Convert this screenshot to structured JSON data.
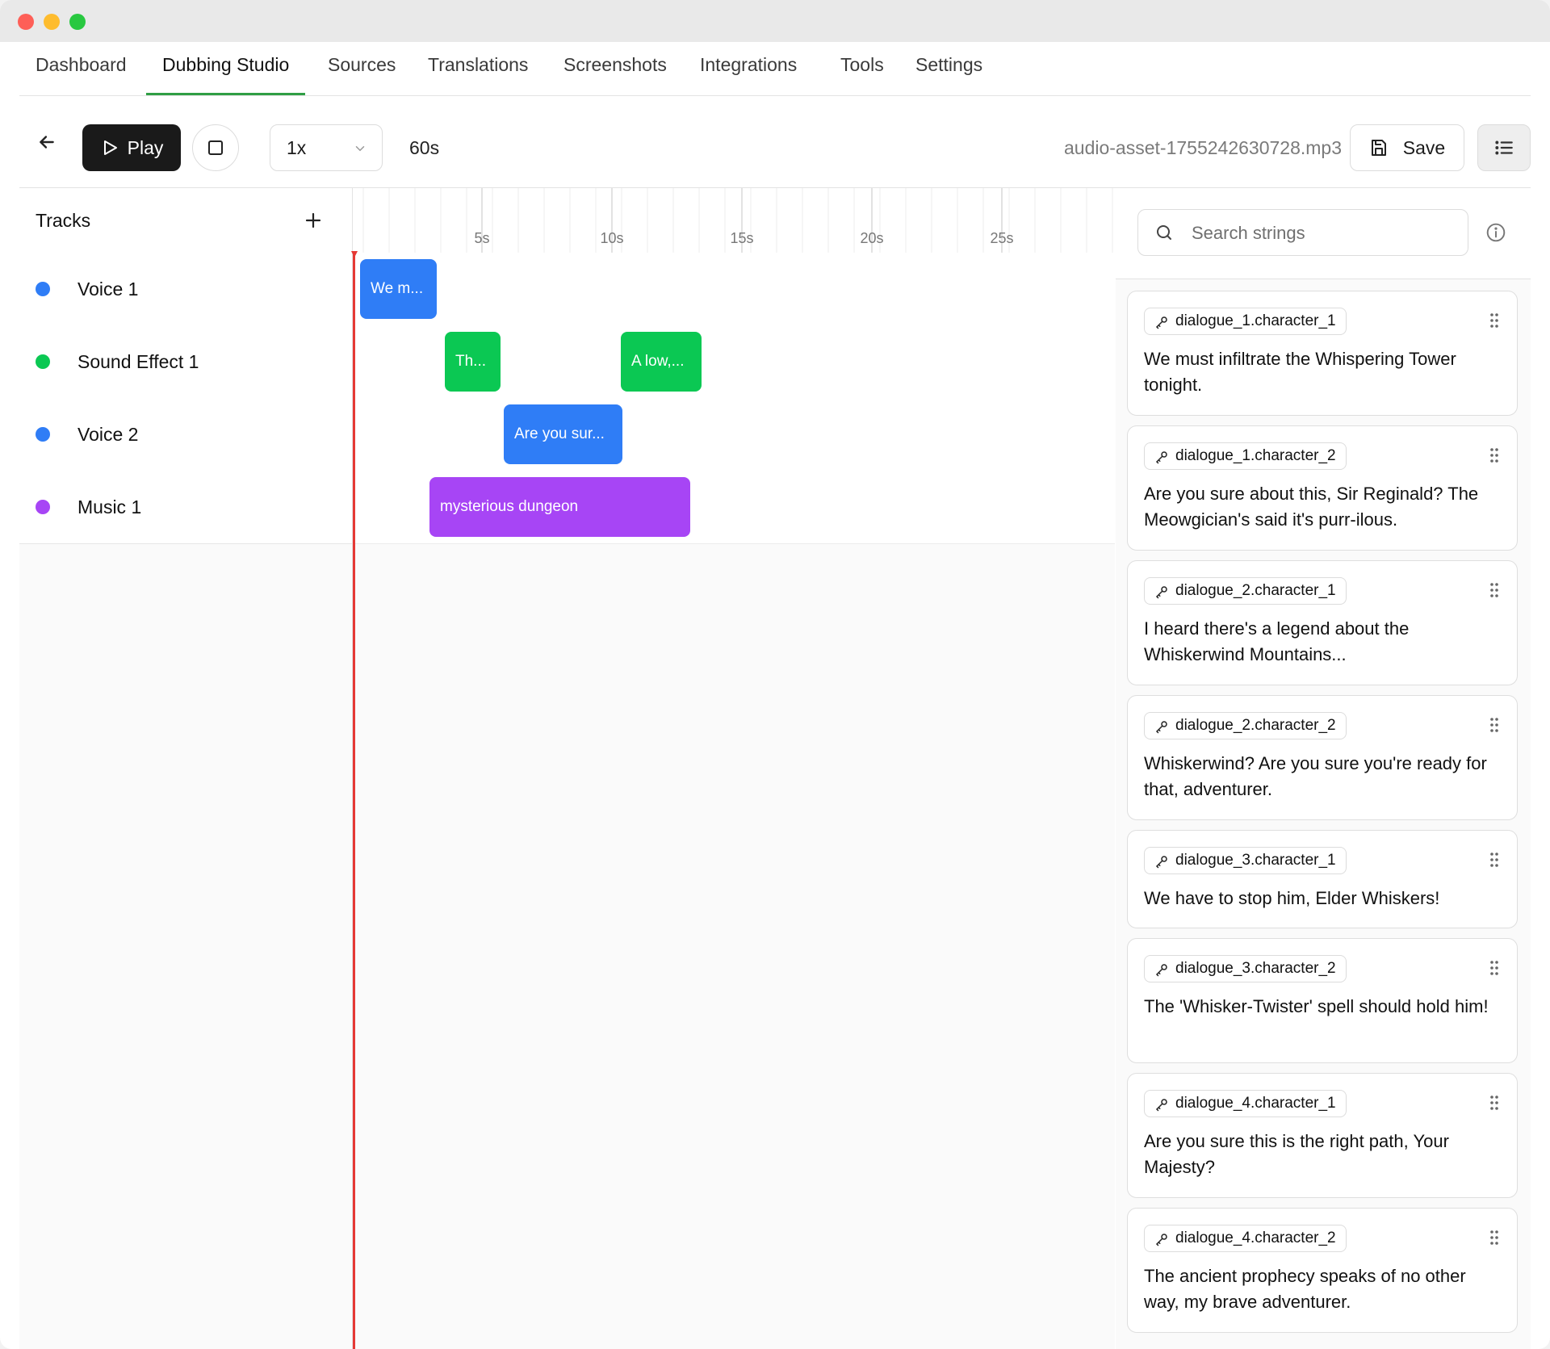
{
  "nav": {
    "tabs": [
      {
        "label": "Dashboard"
      },
      {
        "label": "Dubbing Studio"
      },
      {
        "label": "Sources"
      },
      {
        "label": "Translations"
      },
      {
        "label": "Screenshots"
      },
      {
        "label": "Integrations"
      },
      {
        "label": "Tools"
      },
      {
        "label": "Settings"
      }
    ],
    "active": "Dubbing Studio"
  },
  "toolbar": {
    "play_label": "Play",
    "speed_value": "1x",
    "duration": "60s",
    "filename": "audio-asset-1755242630728.mp3",
    "save_label": "Save"
  },
  "tracks": {
    "title": "Tracks",
    "items": [
      {
        "name": "Voice 1",
        "color": "#2f7df6"
      },
      {
        "name": "Sound Effect 1",
        "color": "#0bc853"
      },
      {
        "name": "Voice 2",
        "color": "#2f7df6"
      },
      {
        "name": "Music 1",
        "color": "#a745f5"
      }
    ]
  },
  "timeline": {
    "tick_labels": [
      "5s",
      "10s",
      "15s",
      "20s",
      "25s"
    ],
    "clips": [
      {
        "track": 0,
        "label": "We m...",
        "color": "#2f7df6"
      },
      {
        "track": 1,
        "label": "Th...",
        "color": "#0bc853"
      },
      {
        "track": 1,
        "label": "A low,...",
        "color": "#0bc853"
      },
      {
        "track": 2,
        "label": "Are you sur...",
        "color": "#2f7df6"
      },
      {
        "track": 3,
        "label": "mysterious dungeon",
        "color": "#a745f5"
      }
    ]
  },
  "strings": {
    "search_placeholder": "Search strings",
    "items": [
      {
        "key": "dialogue_1.character_1",
        "text": "We must infiltrate the Whispering Tower tonight."
      },
      {
        "key": "dialogue_1.character_2",
        "text": "Are you sure about this, Sir Reginald? The Meowgician's said it's purr-ilous."
      },
      {
        "key": "dialogue_2.character_1",
        "text": "I heard there's a legend about the Whiskerwind Mountains..."
      },
      {
        "key": "dialogue_2.character_2",
        "text": "Whiskerwind? Are you sure you're ready for that, adventurer."
      },
      {
        "key": "dialogue_3.character_1",
        "text": "We have to stop him, Elder Whiskers!"
      },
      {
        "key": "dialogue_3.character_2",
        "text": "The 'Whisker-Twister' spell should hold him!"
      },
      {
        "key": "dialogue_4.character_1",
        "text": "Are you sure this is the right path, Your Majesty?"
      },
      {
        "key": "dialogue_4.character_2",
        "text": "The ancient prophecy speaks of no other way, my brave adventurer."
      }
    ]
  }
}
